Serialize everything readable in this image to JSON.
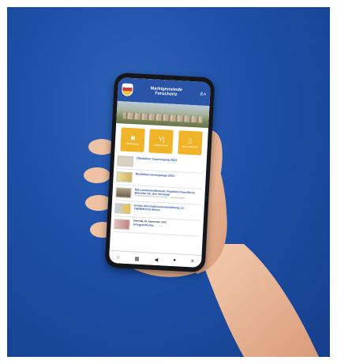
{
  "app": {
    "title_line1": "Marktgemeinde",
    "title_line2": "Feruchertz",
    "lang_icon": "language-icon"
  },
  "tiles": [
    {
      "icon": "camera-icon",
      "glyph": "◙",
      "label": "Mitteilungen"
    },
    {
      "icon": "fork-knife-icon",
      "glyph": "🍴",
      "label": "Gastronomie"
    },
    {
      "icon": "trash-icon",
      "glyph": "🗑",
      "label": "Abfall-\nkalender"
    }
  ],
  "news": [
    {
      "date": "",
      "title": "Ölbekähen Gaumengang 2023",
      "sub": ""
    },
    {
      "date": "",
      "title": "Bartenlammerungstage 2023",
      "sub": ""
    },
    {
      "date": "",
      "title": "NÖ Landesmeilbewerb: Familien-freundliche Betriebe vor den Vorhang!",
      "sub": "Als Familienbetrieb vor den Vorhang ... Landesanstalten"
    },
    {
      "date": "",
      "title": "Online Informationsveranstaltung zur THERMOVIS Aktion",
      "sub": ""
    },
    {
      "date": "Samstag, 16. September 2023",
      "title": "Ortsgeschichte",
      "sub": ""
    }
  ],
  "tabbar": [
    {
      "icon": "home-icon",
      "glyph": "⌂",
      "active": true
    },
    {
      "icon": "calendar-icon",
      "glyph": "▦",
      "active": false
    },
    {
      "icon": "megaphone-icon",
      "glyph": "📢",
      "active": false
    },
    {
      "icon": "info-icon",
      "glyph": "ℹ",
      "active": false
    },
    {
      "icon": "menu-icon",
      "glyph": "≡",
      "active": false
    }
  ],
  "colors": {
    "background": "#1d4fa6",
    "app_header": "#2a54a8",
    "tile": "#f0b429",
    "skin": "#efc2a4"
  }
}
